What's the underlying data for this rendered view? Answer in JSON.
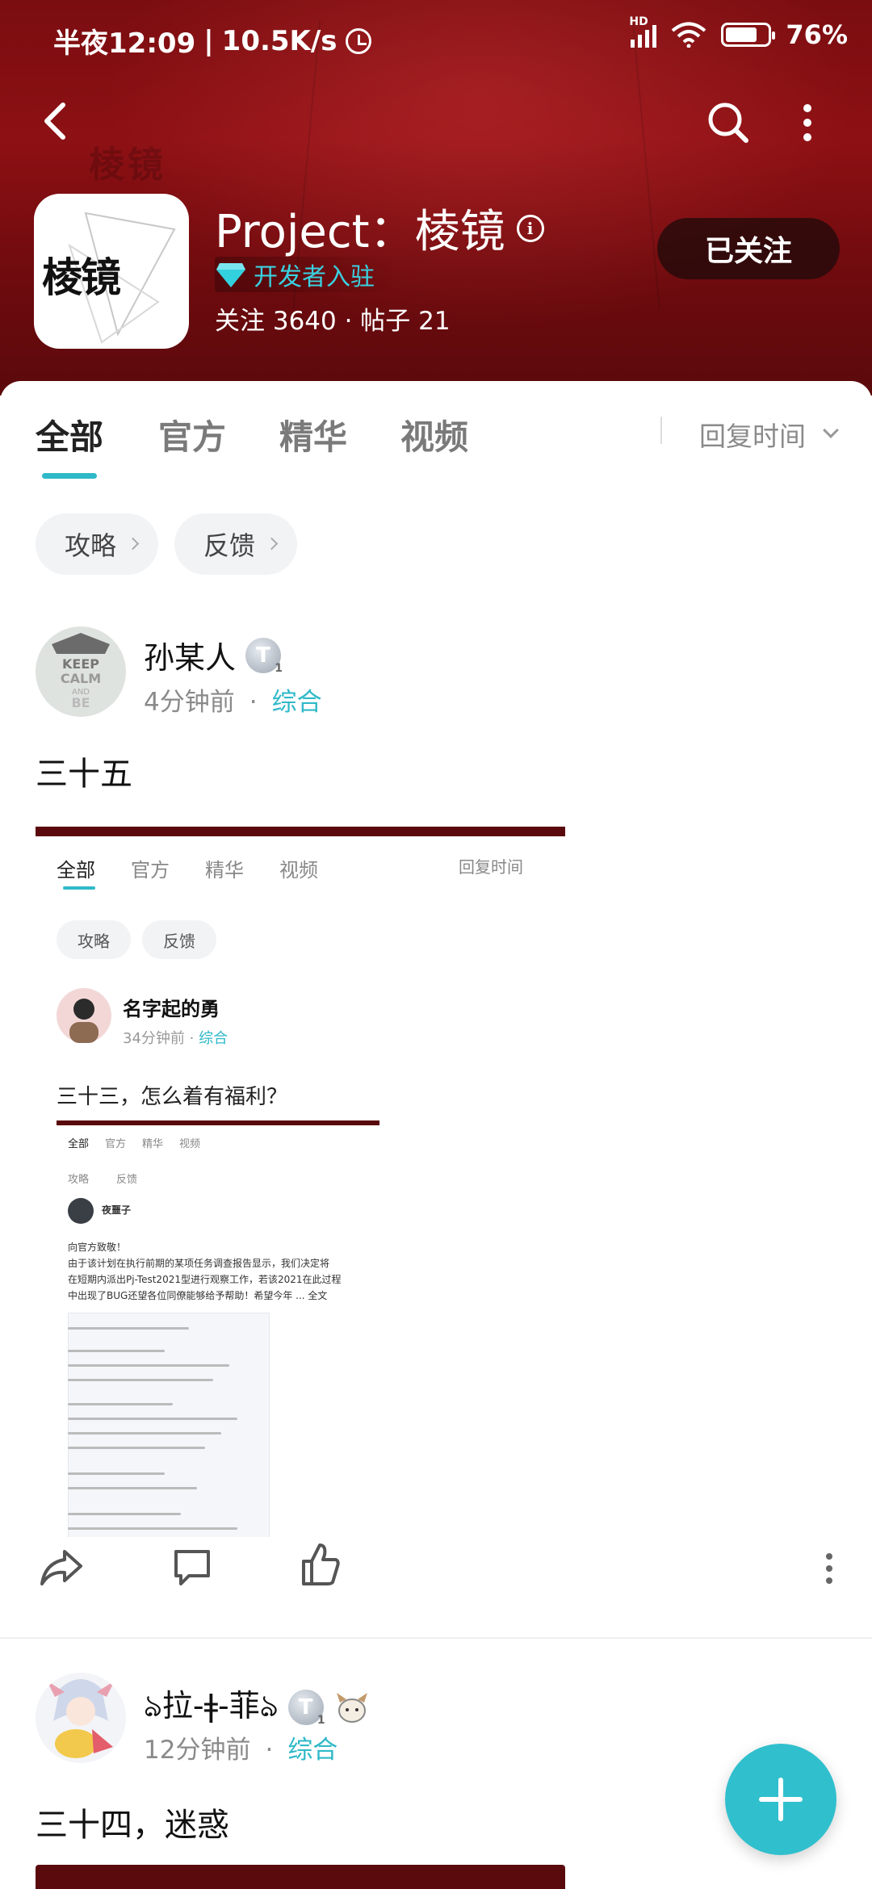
{
  "status_bar": {
    "time": "半夜12:09",
    "net_speed": "10.5K/s",
    "battery": "76%",
    "network_badge": "HD"
  },
  "forum": {
    "name": "Project：棱镜",
    "logo_text": "棱镜",
    "badge": "开发者入驻",
    "stats": "关注 3640 · 帖子 21",
    "follow_label": "已关注"
  },
  "tabs": [
    "全部",
    "官方",
    "精华",
    "视频"
  ],
  "sort_label": "回复时间",
  "chips": [
    "攻略",
    "反馈"
  ],
  "posts": [
    {
      "author": "孙某人",
      "level": "T",
      "time": "4分钟前",
      "category": "综合",
      "text": "三十五",
      "embedded": {
        "tabs": [
          "全部",
          "官方",
          "精华",
          "视频"
        ],
        "sort_label": "回复时间",
        "chips": [
          "攻略",
          "反馈"
        ],
        "author": "名字起的勇",
        "time": "34分钟前",
        "category": "综合",
        "text": "三十三，怎么着有福利？",
        "inner": {
          "tabs": [
            "全部",
            "官方",
            "精华",
            "视频"
          ],
          "chips": [
            "攻略",
            "反馈"
          ],
          "author": "夜噩子",
          "text_lines": [
            "向官方致敬！",
            "由于该计划在执行前期的某项任务调查报告显示，我们决定将",
            "在短期内派出Pj-Test2021型进行观察工作，若该2021在此过程",
            "中出现了BUG还望各位同僚能够给予帮助！希望今年 ... 全文"
          ]
        }
      }
    },
    {
      "author": "ঌ拉-ǂ-菲ঌ",
      "level": "T",
      "time": "12分钟前",
      "category": "综合",
      "text": "三十四，迷惑"
    }
  ],
  "colors": {
    "accent": "#2fb9c8",
    "header_red": "#8d1014"
  },
  "icons": [
    "back-icon",
    "search-icon",
    "more-icon",
    "info-icon",
    "diamond-icon",
    "share-icon",
    "comment-icon",
    "like-icon",
    "plus-icon"
  ]
}
